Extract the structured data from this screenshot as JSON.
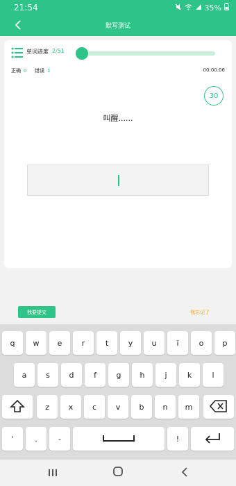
{
  "status_bar": {
    "time": "21:54",
    "battery": "35%"
  },
  "app_bar": {
    "title": "默写测试"
  },
  "progress": {
    "label": "单词进度",
    "count": "2/51",
    "fraction": 0.039
  },
  "stats": {
    "correct_label": "正确",
    "correct_value": "0",
    "wrong_label": "错误",
    "wrong_value": "1",
    "timer": "00:00:06"
  },
  "countdown": "30",
  "prompt": "叫醒......",
  "actions": {
    "submit": "我要提交",
    "forgot": "我忘记了"
  },
  "keyboard": {
    "row1": [
      "q",
      "w",
      "e",
      "r",
      "t",
      "y",
      "u",
      "i",
      "o",
      "p"
    ],
    "row2": [
      "a",
      "s",
      "d",
      "f",
      "g",
      "h",
      "j",
      "k",
      "l"
    ],
    "row3": [
      "z",
      "x",
      "c",
      "v",
      "b",
      "n",
      "m"
    ],
    "row4": [
      "'",
      ".",
      "-",
      "!"
    ]
  },
  "colors": {
    "accent": "#2ec487",
    "warning": "#f5a623"
  }
}
